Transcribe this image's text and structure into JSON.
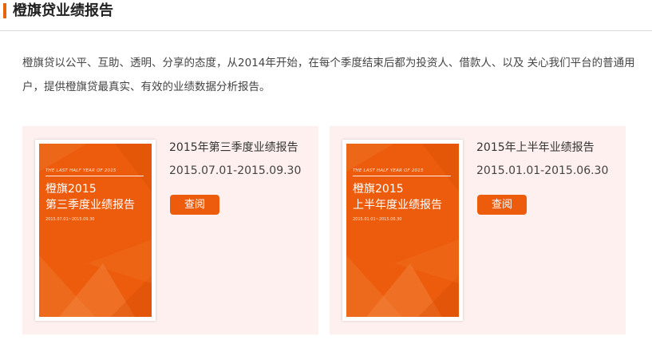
{
  "header": {
    "title": "橙旗贷业绩报告",
    "accent_color": "#e8640c"
  },
  "intro": {
    "text": "橙旗贷以公平、互助、透明、分享的态度，从2014年开始，在每个季度结束后都为投资人、借款人、以及 关心我们平台的普通用户，提供橙旗贷最真实、有效的业绩数据分析报告。"
  },
  "reports": [
    {
      "title": "2015年第三季度业绩报告",
      "range": "2015.07.01-2015.09.30",
      "button_label": "查阅",
      "cover": {
        "en_text": "THE LAST HALF YEAR OF 2015",
        "line1": "橙旗2015",
        "line2": "第三季度业绩报告",
        "date": "2015.07.01~2015.09.30",
        "color": "#ec5c0c"
      }
    },
    {
      "title": "2015年上半年业绩报告",
      "range": "2015.01.01-2015.06.30",
      "button_label": "查阅",
      "cover": {
        "en_text": "THE LAST HALF YEAR OF 2015",
        "line1": "橙旗2015",
        "line2": "上半年度业绩报告",
        "date": "2015.01.01~2015.06.30",
        "color": "#ec5c0c"
      }
    }
  ]
}
